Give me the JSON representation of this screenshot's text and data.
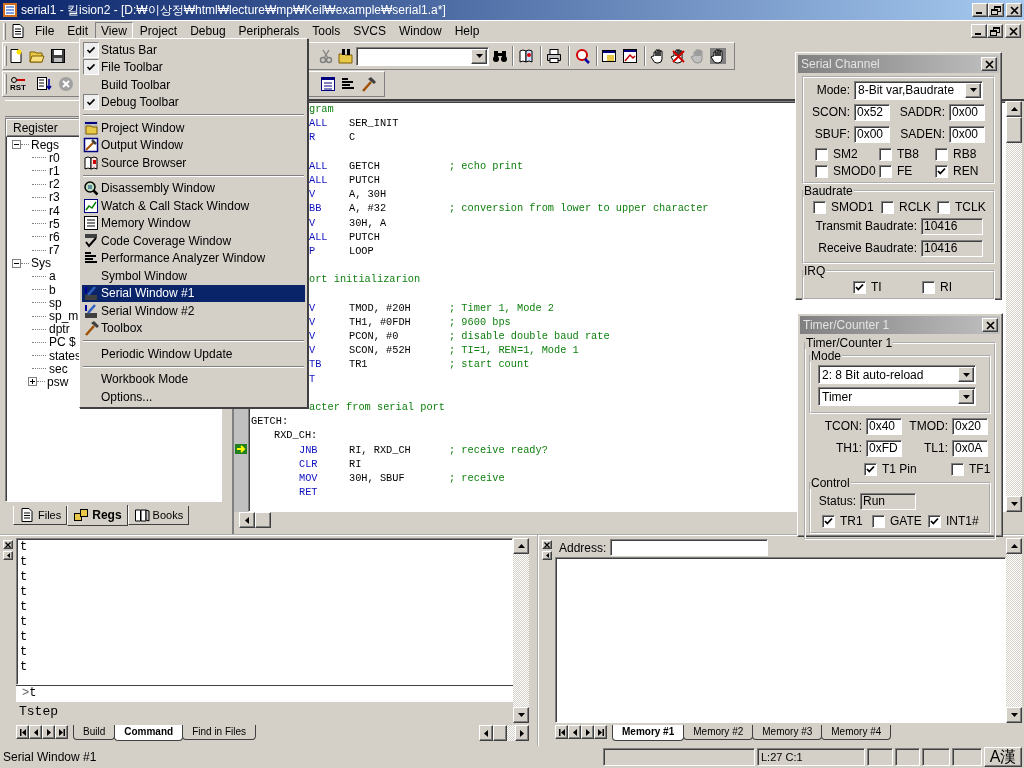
{
  "window": {
    "title": "serial1  - 킬ision2 - [D:₩이상정₩html₩lecture₩mp₩Keil₩example₩serial1.a*]"
  },
  "menu_bar": [
    {
      "label": "File",
      "selected": false
    },
    {
      "label": "Edit",
      "selected": false
    },
    {
      "label": "View",
      "selected": true
    },
    {
      "label": "Project",
      "selected": false
    },
    {
      "label": "Debug",
      "selected": false
    },
    {
      "label": "Peripherals",
      "selected": false
    },
    {
      "label": "Tools",
      "selected": false
    },
    {
      "label": "SVCS",
      "selected": false
    },
    {
      "label": "Window",
      "selected": false
    },
    {
      "label": "Help",
      "selected": false
    }
  ],
  "debug_toolbar": {
    "reset_label": "RST"
  },
  "view_menu": [
    {
      "kind": "item",
      "label": "Status Bar",
      "checked": true,
      "selected": false
    },
    {
      "kind": "item",
      "label": "File Toolbar",
      "checked": true,
      "selected": false
    },
    {
      "kind": "item",
      "label": "Build Toolbar",
      "checked": false,
      "selected": false
    },
    {
      "kind": "item",
      "label": "Debug Toolbar",
      "checked": true,
      "selected": false
    },
    {
      "kind": "separator"
    },
    {
      "kind": "item",
      "label": "Project Window",
      "checked": false,
      "selected": false
    },
    {
      "kind": "item",
      "label": "Output Window",
      "checked": false,
      "selected": false
    },
    {
      "kind": "item",
      "label": "Source Browser",
      "checked": false,
      "selected": false
    },
    {
      "kind": "separator"
    },
    {
      "kind": "item",
      "label": "Disassembly Window",
      "checked": false,
      "selected": false
    },
    {
      "kind": "item",
      "label": "Watch & Call Stack Window",
      "checked": false,
      "selected": false
    },
    {
      "kind": "item",
      "label": "Memory Window",
      "checked": false,
      "selected": false
    },
    {
      "kind": "item",
      "label": "Code Coverage Window",
      "checked": false,
      "selected": false
    },
    {
      "kind": "item",
      "label": "Performance Analyzer Window",
      "checked": false,
      "selected": false
    },
    {
      "kind": "item",
      "label": "Symbol Window",
      "checked": false,
      "selected": false
    },
    {
      "kind": "item",
      "label": "Serial  Window #1",
      "checked": false,
      "selected": true
    },
    {
      "kind": "item",
      "label": "Serial  Window #2",
      "checked": false,
      "selected": false
    },
    {
      "kind": "item",
      "label": "Toolbox",
      "checked": false,
      "selected": false
    },
    {
      "kind": "separator"
    },
    {
      "kind": "item",
      "label": "Periodic Window Update",
      "checked": false,
      "selected": false
    },
    {
      "kind": "separator"
    },
    {
      "kind": "item",
      "label": "Workbook Mode",
      "checked": false,
      "selected": false
    },
    {
      "kind": "item",
      "label": "Options...",
      "checked": false,
      "selected": false
    }
  ],
  "register_pane": {
    "header": "Register",
    "tree": [
      {
        "label": "Regs",
        "expanded": true,
        "children": [
          {
            "label": "r0"
          },
          {
            "label": "r1"
          },
          {
            "label": "r2"
          },
          {
            "label": "r3"
          },
          {
            "label": "r4"
          },
          {
            "label": "r5"
          },
          {
            "label": "r6"
          },
          {
            "label": "r7"
          }
        ]
      },
      {
        "label": "Sys",
        "expanded": true,
        "children": [
          {
            "label": "a"
          },
          {
            "label": "b"
          },
          {
            "label": "sp"
          },
          {
            "label": "sp_m"
          },
          {
            "label": "dptr"
          },
          {
            "label": "PC  $"
          },
          {
            "label": "states"
          },
          {
            "label": "sec"
          },
          {
            "label": "psw",
            "expanded": false
          }
        ]
      }
    ],
    "tabs": [
      {
        "label": "Files",
        "selected": false
      },
      {
        "label": "Regs",
        "selected": true
      },
      {
        "label": "Books",
        "selected": false
      }
    ]
  },
  "editor": {
    "lines": [
      {
        "kind": "comment",
        "comment": "gram"
      },
      {
        "kind": "cut",
        "mnemonic": "ALL",
        "operands": "SER_INIT"
      },
      {
        "kind": "cut",
        "mnemonic": "R",
        "operands": "C"
      },
      {
        "kind": "blank"
      },
      {
        "kind": "cut",
        "mnemonic": "ALL",
        "operands": "GETCH",
        "comment": "; echo print"
      },
      {
        "kind": "cut",
        "mnemonic": "ALL",
        "operands": "PUTCH"
      },
      {
        "kind": "cut",
        "mnemonic": "V",
        "operands": "A, 30H"
      },
      {
        "kind": "cut",
        "mnemonic": "BB",
        "operands": "A, #32",
        "comment": "; conversion from lower to upper character"
      },
      {
        "kind": "cut",
        "mnemonic": "V",
        "operands": "30H, A"
      },
      {
        "kind": "cut",
        "mnemonic": "ALL",
        "operands": "PUTCH"
      },
      {
        "kind": "cut",
        "mnemonic": "P",
        "operands": "LOOP"
      },
      {
        "kind": "blank"
      },
      {
        "kind": "comment",
        "comment": "ort initializarion"
      },
      {
        "kind": "blank"
      },
      {
        "kind": "cut",
        "mnemonic": "V",
        "operands": "TMOD, #20H",
        "comment": "; Timer 1, Mode 2"
      },
      {
        "kind": "cut",
        "mnemonic": "V",
        "operands": "TH1, #0FDH",
        "comment": "; 9600 bps"
      },
      {
        "kind": "cut",
        "mnemonic": "V",
        "operands": "PCON, #0",
        "comment": "; disable double baud rate"
      },
      {
        "kind": "cut",
        "mnemonic": "V",
        "operands": "SCON, #52H",
        "comment": "; TI=1, REN=1, Mode 1"
      },
      {
        "kind": "cut",
        "mnemonic": "TB",
        "operands": "TR1",
        "comment": "; start count"
      },
      {
        "kind": "cut",
        "mnemonic": "T"
      },
      {
        "kind": "blank"
      },
      {
        "kind": "comment",
        "comment": "acter from serial port"
      },
      {
        "kind": "label",
        "label": "GETCH:"
      },
      {
        "kind": "sublabel",
        "label": "RXD_CH:"
      },
      {
        "kind": "code",
        "mnemonic": "JNB",
        "operands": "RI, RXD_CH",
        "comment": "; receive ready?",
        "current": true
      },
      {
        "kind": "code",
        "mnemonic": "CLR",
        "operands": "RI"
      },
      {
        "kind": "code",
        "mnemonic": "MOV",
        "operands": "30H, SBUF",
        "comment": "; receive"
      },
      {
        "kind": "code",
        "mnemonic": "RET"
      }
    ]
  },
  "serial_channel": {
    "title": "Serial Channel",
    "mode_label": "Mode:",
    "mode_value": "8-Bit var,Baudrate",
    "registers": [
      {
        "label": "SCON:",
        "value": "0x52"
      },
      {
        "label": "SADDR:",
        "value": "0x00"
      },
      {
        "label": "SBUF:",
        "value": "0x00"
      },
      {
        "label": "SADEN:",
        "value": "0x00"
      }
    ],
    "flags": [
      {
        "label": "SM2",
        "checked": false
      },
      {
        "label": "TB8",
        "checked": false
      },
      {
        "label": "RB8",
        "checked": false
      },
      {
        "label": "SMOD0",
        "checked": false
      },
      {
        "label": "FE",
        "checked": false
      },
      {
        "label": "REN",
        "checked": true
      }
    ],
    "baudrate": {
      "title": "Baudrate",
      "flags": [
        {
          "label": "SMOD1",
          "checked": false
        },
        {
          "label": "RCLK",
          "checked": false
        },
        {
          "label": "TCLK",
          "checked": false
        }
      ],
      "fields": [
        {
          "label": "Transmit Baudrate:",
          "value": "10416"
        },
        {
          "label": "Receive Baudrate:",
          "value": "10416"
        }
      ]
    },
    "irq": {
      "title": "IRQ",
      "flags": [
        {
          "label": "TI",
          "checked": true
        },
        {
          "label": "RI",
          "checked": false
        }
      ]
    }
  },
  "timer_counter": {
    "title": "Timer/Counter 1",
    "group_title": "Timer/Counter 1",
    "mode": {
      "title": "Mode",
      "selects": [
        "2: 8 Bit auto-reload",
        "Timer"
      ]
    },
    "registers": [
      {
        "label": "TCON:",
        "value": "0x40"
      },
      {
        "label": "TMOD:",
        "value": "0x20"
      },
      {
        "label": "TH1:",
        "value": "0xFD"
      },
      {
        "label": "TL1:",
        "value": "0x0A"
      }
    ],
    "flags": [
      {
        "label": "T1 Pin",
        "checked": true
      },
      {
        "label": "TF1",
        "checked": false
      }
    ],
    "control": {
      "title": "Control",
      "status_label": "Status:",
      "status_value": "Run",
      "flags": [
        {
          "label": "TR1",
          "checked": true
        },
        {
          "label": "GATE",
          "checked": false
        },
        {
          "label": "INT1#",
          "checked": true
        }
      ]
    }
  },
  "output_window": {
    "lines": [
      "t",
      "t",
      "t",
      "t",
      "t",
      "t",
      "t",
      "t",
      "t"
    ],
    "prompt": ">",
    "command": "t",
    "status": "Tstep",
    "tabs": [
      {
        "label": "Build",
        "selected": false
      },
      {
        "label": "Command",
        "selected": true
      },
      {
        "label": "Find in Files",
        "selected": false
      }
    ]
  },
  "memory_window": {
    "address_label": "Address:",
    "tabs": [
      {
        "label": "Memory #1",
        "selected": true
      },
      {
        "label": "Memory #2",
        "selected": false
      },
      {
        "label": "Memory #3",
        "selected": false
      },
      {
        "label": "Memory #4",
        "selected": false
      }
    ]
  },
  "status_bar": {
    "text": "Serial Window #1",
    "position": "L:27 C:1",
    "ime": "A漢"
  }
}
